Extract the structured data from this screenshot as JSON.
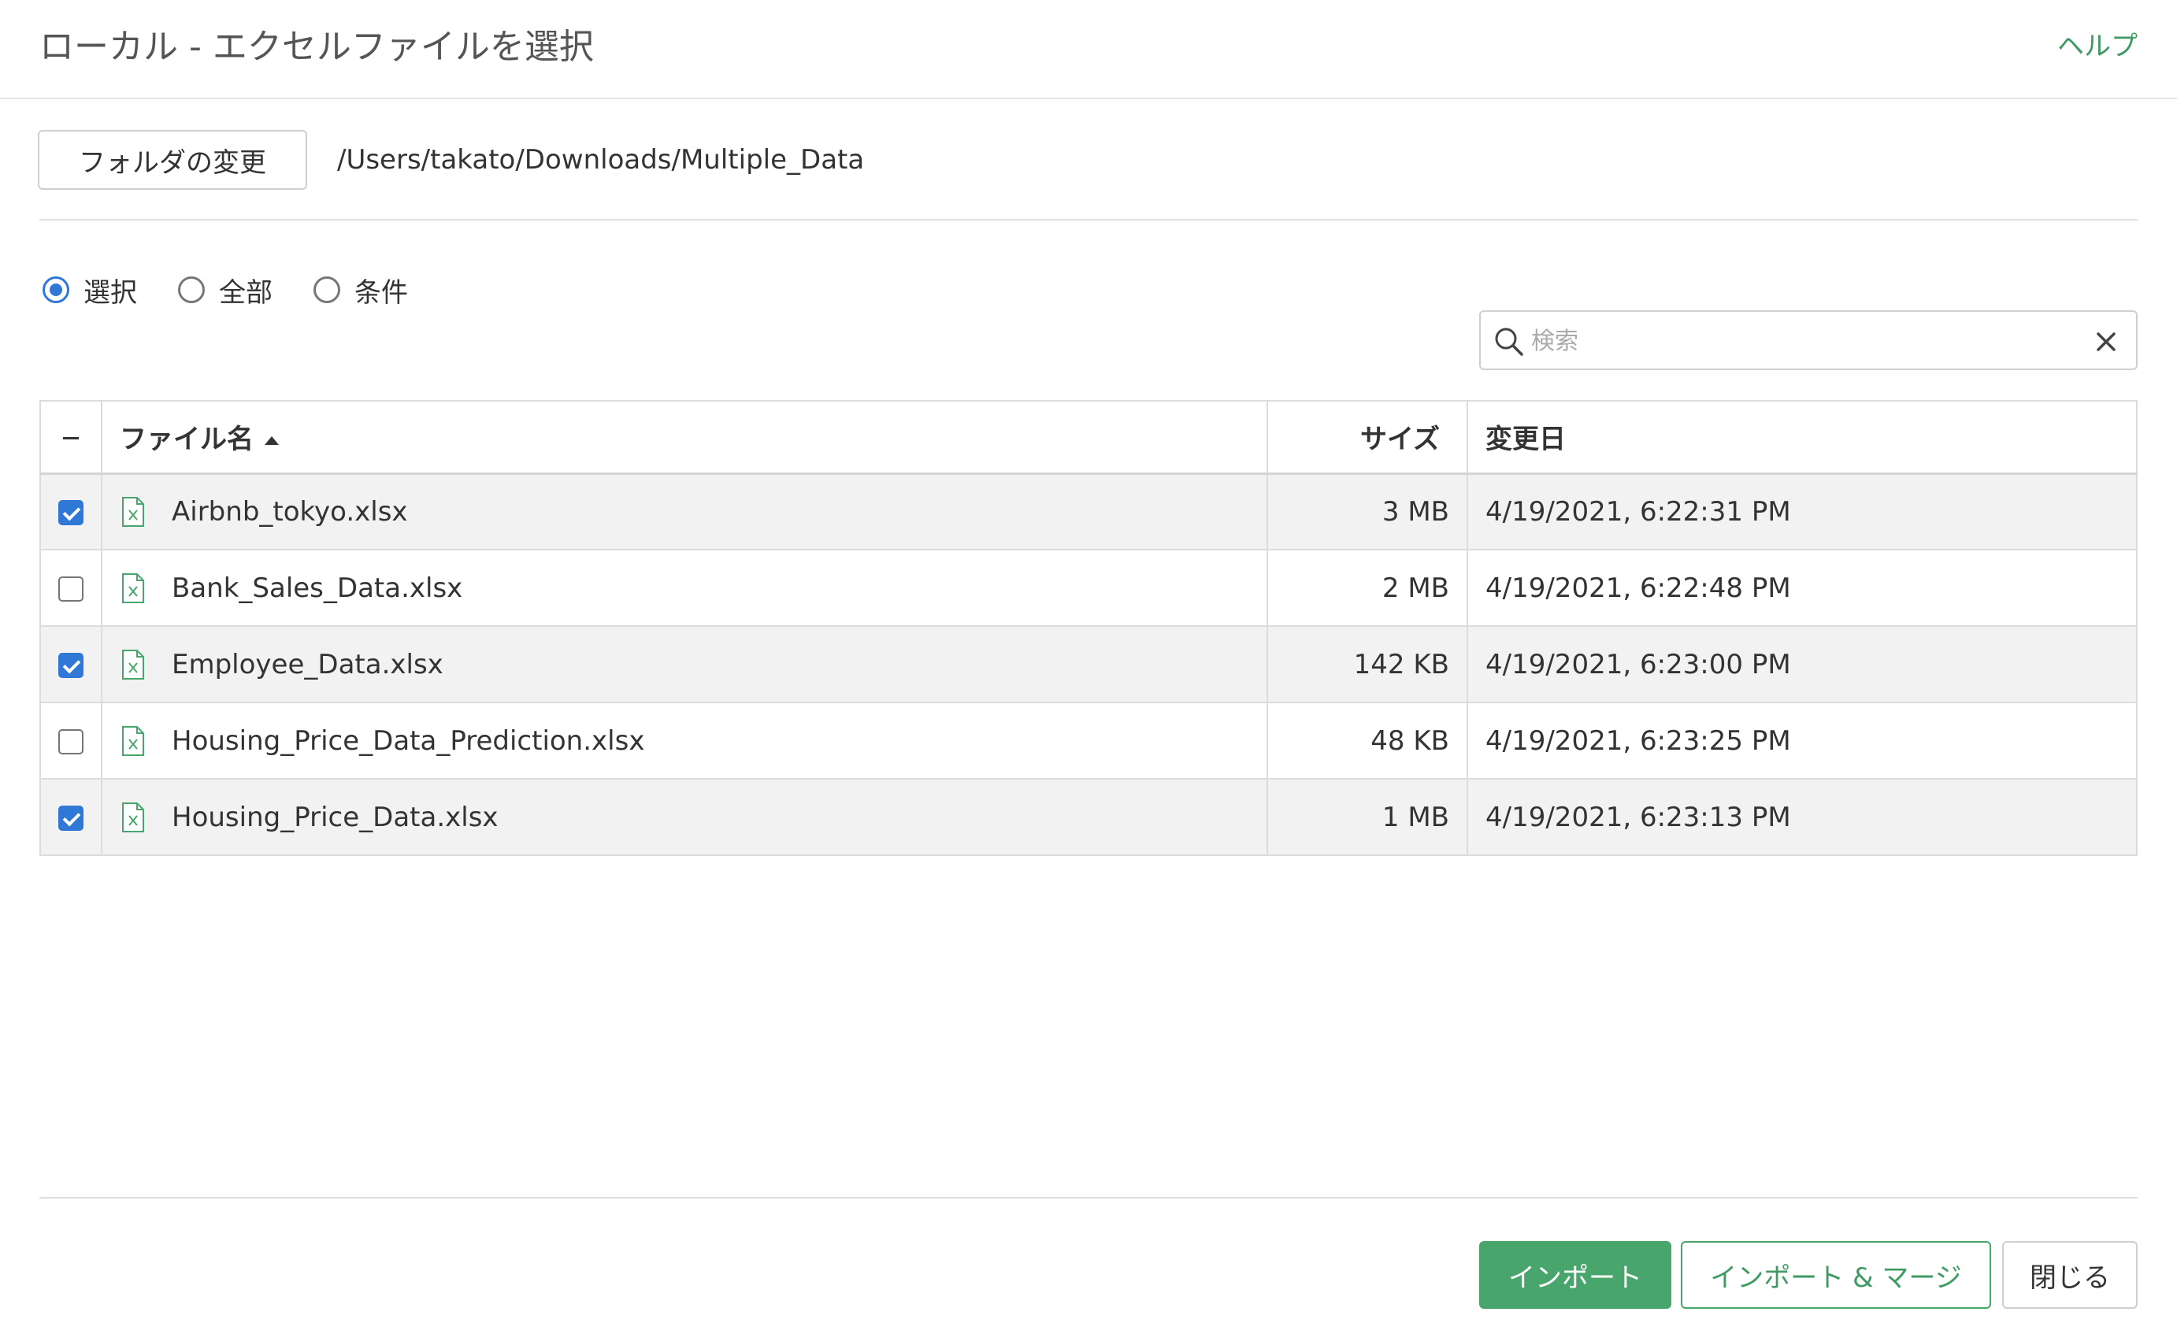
{
  "header": {
    "title": "ローカル - エクセルファイルを選択",
    "help_label": "ヘルプ"
  },
  "folder": {
    "change_button_label": "フォルダの変更",
    "path": "/Users/takato/Downloads/Multiple_Data"
  },
  "selection_mode": {
    "options": [
      {
        "label": "選択",
        "checked": true
      },
      {
        "label": "全部",
        "checked": false
      },
      {
        "label": "条件",
        "checked": false
      }
    ]
  },
  "search": {
    "placeholder": "検索",
    "value": ""
  },
  "table": {
    "columns": {
      "name": "ファイル名",
      "size": "サイズ",
      "modified": "変更日"
    },
    "sort_column": "name",
    "sort_direction": "ascending",
    "rows": [
      {
        "checked": true,
        "name": "Airbnb_tokyo.xlsx",
        "size": "3 MB",
        "modified": "4/19/2021, 6:22:31 PM"
      },
      {
        "checked": false,
        "name": "Bank_Sales_Data.xlsx",
        "size": "2 MB",
        "modified": "4/19/2021, 6:22:48 PM"
      },
      {
        "checked": true,
        "name": "Employee_Data.xlsx",
        "size": "142 KB",
        "modified": "4/19/2021, 6:23:00 PM"
      },
      {
        "checked": false,
        "name": "Housing_Price_Data_Prediction.xlsx",
        "size": "48 KB",
        "modified": "4/19/2021, 6:23:25 PM"
      },
      {
        "checked": true,
        "name": "Housing_Price_Data.xlsx",
        "size": "1 MB",
        "modified": "4/19/2021, 6:23:13 PM"
      }
    ]
  },
  "footer": {
    "import_label": "インポート",
    "import_merge_label": "インポート & マージ",
    "close_label": "閉じる"
  },
  "colors": {
    "accent_green": "#48a56b",
    "checkbox_blue": "#2f78d6",
    "row_shade": "#f2f2f2"
  }
}
